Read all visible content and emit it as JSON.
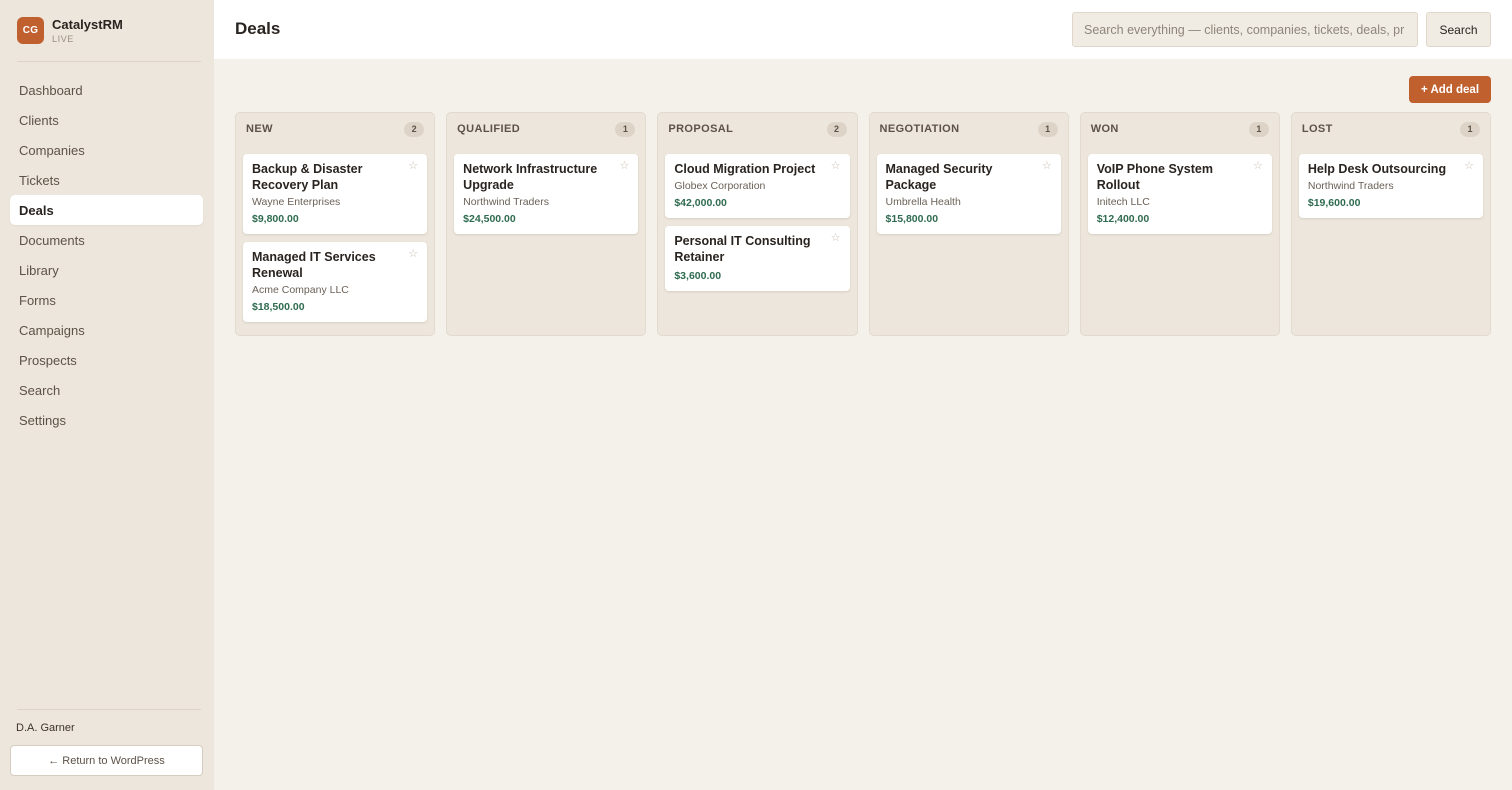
{
  "app": {
    "logo_initials": "CG",
    "name": "CatalystRM",
    "env": "LIVE"
  },
  "nav": [
    {
      "label": "Dashboard",
      "active": false
    },
    {
      "label": "Clients",
      "active": false
    },
    {
      "label": "Companies",
      "active": false
    },
    {
      "label": "Tickets",
      "active": false
    },
    {
      "label": "Deals",
      "active": true
    },
    {
      "label": "Documents",
      "active": false
    },
    {
      "label": "Library",
      "active": false
    },
    {
      "label": "Forms",
      "active": false
    },
    {
      "label": "Campaigns",
      "active": false
    },
    {
      "label": "Prospects",
      "active": false
    },
    {
      "label": "Search",
      "active": false
    },
    {
      "label": "Settings",
      "active": false
    }
  ],
  "user": {
    "name": "D.A. Garner"
  },
  "return_label": "← Return to WordPress",
  "header": {
    "title": "Deals",
    "search_placeholder": "Search everything — clients, companies, tickets, deals, pr",
    "search_label": "Search"
  },
  "add_deal_label": "+ Add deal",
  "colors": {
    "accent": "#c0602f",
    "value_green": "#2f6b4f",
    "sidebar_bg": "#ede6dc",
    "page_bg": "#f4f1ea"
  },
  "columns": [
    {
      "title": "NEW",
      "count": "2",
      "cards": [
        {
          "title": "Backup & Disaster Recovery Plan",
          "company": "Wayne Enterprises",
          "value": "$9,800.00",
          "star": "☆"
        },
        {
          "title": "Managed IT Services Renewal",
          "company": "Acme Company LLC",
          "value": "$18,500.00",
          "star": "☆"
        }
      ]
    },
    {
      "title": "QUALIFIED",
      "count": "1",
      "cards": [
        {
          "title": "Network Infrastructure Upgrade",
          "company": "Northwind Traders",
          "value": "$24,500.00",
          "star": "☆"
        }
      ]
    },
    {
      "title": "PROPOSAL",
      "count": "2",
      "cards": [
        {
          "title": "Cloud Migration Project",
          "company": "Globex Corporation",
          "value": "$42,000.00",
          "star": "☆"
        },
        {
          "title": "Personal IT Consulting Retainer",
          "company": "",
          "value": "$3,600.00",
          "star": "☆"
        }
      ]
    },
    {
      "title": "NEGOTIATION",
      "count": "1",
      "cards": [
        {
          "title": "Managed Security Package",
          "company": "Umbrella Health",
          "value": "$15,800.00",
          "star": "☆"
        }
      ]
    },
    {
      "title": "WON",
      "count": "1",
      "cards": [
        {
          "title": "VoIP Phone System Rollout",
          "company": "Initech LLC",
          "value": "$12,400.00",
          "star": "☆"
        }
      ]
    },
    {
      "title": "LOST",
      "count": "1",
      "cards": [
        {
          "title": "Help Desk Outsourcing",
          "company": "Northwind Traders",
          "value": "$19,600.00",
          "star": "☆"
        }
      ]
    }
  ]
}
